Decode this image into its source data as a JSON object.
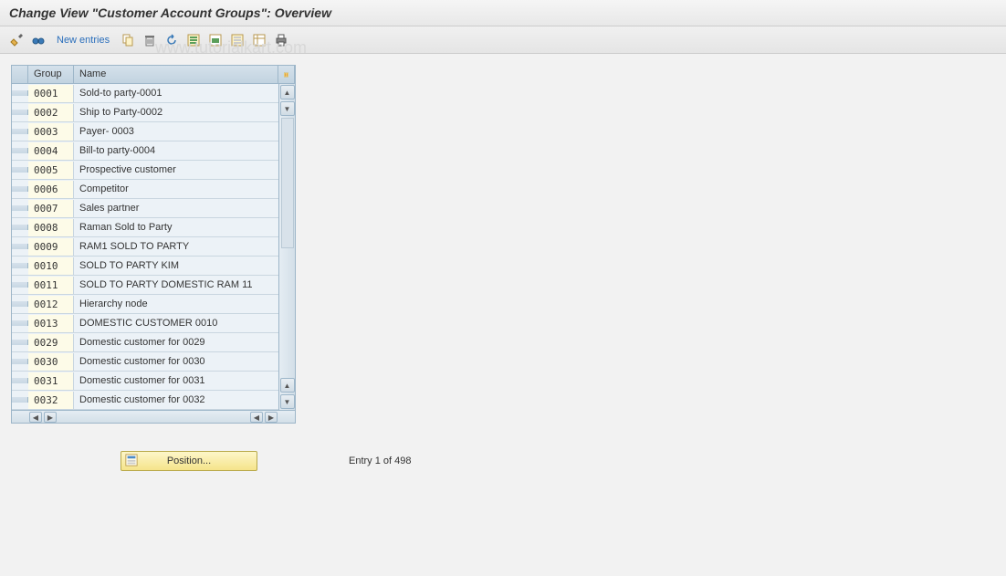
{
  "title": "Change View \"Customer Account Groups\": Overview",
  "watermark": "www.tutorialkart.com",
  "toolbar": {
    "new_entries": "New entries"
  },
  "table": {
    "headers": {
      "group": "Group",
      "name": "Name"
    },
    "rows": [
      {
        "group": "0001",
        "name": "Sold-to party-0001"
      },
      {
        "group": "0002",
        "name": "Ship to Party-0002"
      },
      {
        "group": "0003",
        "name": "Payer- 0003"
      },
      {
        "group": "0004",
        "name": "Bill-to party-0004"
      },
      {
        "group": "0005",
        "name": "Prospective customer"
      },
      {
        "group": "0006",
        "name": "Competitor"
      },
      {
        "group": "0007",
        "name": "Sales partner"
      },
      {
        "group": "0008",
        "name": "Raman Sold to Party"
      },
      {
        "group": "0009",
        "name": "RAM1 SOLD TO PARTY"
      },
      {
        "group": "0010",
        "name": "SOLD TO PARTY KIM"
      },
      {
        "group": "0011",
        "name": "SOLD TO PARTY DOMESTIC RAM 11"
      },
      {
        "group": "0012",
        "name": "Hierarchy node"
      },
      {
        "group": "0013",
        "name": "DOMESTIC CUSTOMER 0010"
      },
      {
        "group": "0029",
        "name": "Domestic customer for  0029"
      },
      {
        "group": "0030",
        "name": "Domestic customer for  0030"
      },
      {
        "group": "0031",
        "name": "Domestic customer for  0031"
      },
      {
        "group": "0032",
        "name": "Domestic customer for  0032"
      }
    ]
  },
  "footer": {
    "position_label": "Position...",
    "entry_text": "Entry 1 of 498"
  }
}
